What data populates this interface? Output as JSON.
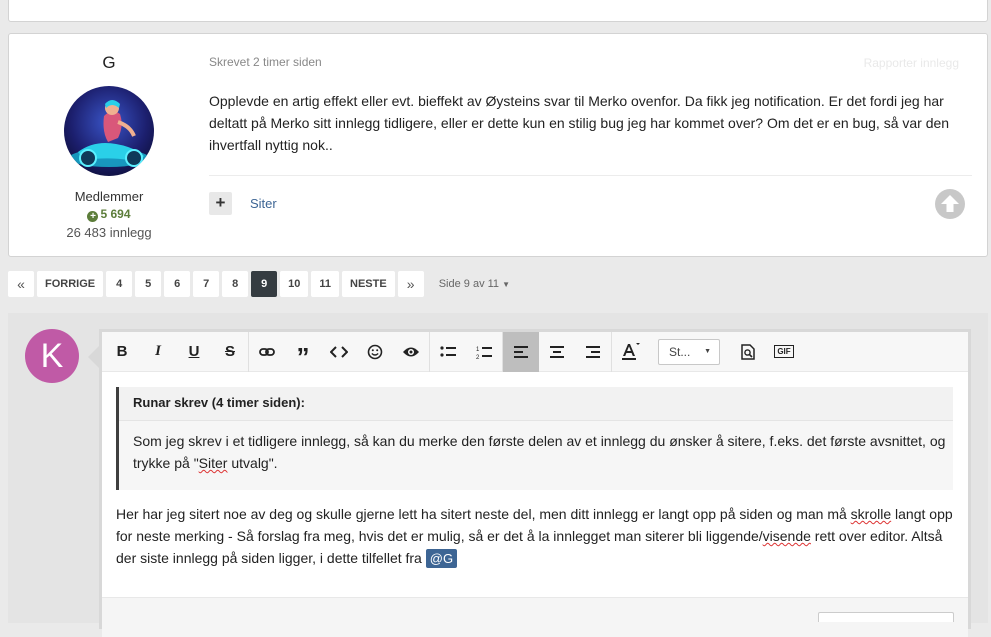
{
  "post": {
    "author": "G",
    "group": "Medlemmer",
    "reputation": "5 694",
    "post_count": "26 483 innlegg",
    "timestamp": "Skrevet 2 timer siden",
    "report_label": "Rapporter innlegg",
    "body": "Opplevde en artig effekt eller evt. bieffekt av Øysteins svar til Merko ovenfor. Da fikk jeg notification. Er det fordi jeg har deltatt på Merko sitt innlegg tidligere, eller er dette kun en stilig bug jeg har kommet over? Om det er en bug, så var den ihvertfall nyttig nok..",
    "multiquote_label": "+",
    "quote_label": "Siter"
  },
  "pagination": {
    "prev": "FORRIGE",
    "pages": [
      "4",
      "5",
      "6",
      "7",
      "8",
      "9",
      "10",
      "11"
    ],
    "current": "9",
    "next": "NESTE",
    "page_info": "Side 9 av 11"
  },
  "reply": {
    "avatar_letter": "K",
    "style_select": "St...",
    "quote_header": "Runar skrev (4 timer siden):",
    "quote_text_a": "Som jeg skrev i et tidligere innlegg, så kan du merke den første delen av et innlegg du ønsker å sitere, f.eks. det første avsnittet, og trykke på \"",
    "quote_text_word": "Siter",
    "quote_text_b": " utvalg\".",
    "text_a": "Her har jeg sitert noe av deg og skulle gjerne lett ha sitert neste del, men ditt innlegg er langt opp på siden og man må ",
    "text_word1": "skrolle",
    "text_b": " langt opp for neste merking - Så forslag fra meg, hvis det er mulig, så er det å la innlegget man siterer bli liggende/",
    "text_word2": "visende",
    "text_c": " rett over editor. Altså der siste innlegg på siden ligger, i dette tilfellet fra ",
    "mention": "@G"
  },
  "icons": {
    "bold": "B",
    "italic": "I",
    "underline": "U",
    "strike": "S",
    "gif": "GIF"
  },
  "colors": {
    "accent": "#3d6594",
    "reputation": "#5c7d3a",
    "active_page": "#353c41",
    "avatar_k": "#c05aa6"
  }
}
